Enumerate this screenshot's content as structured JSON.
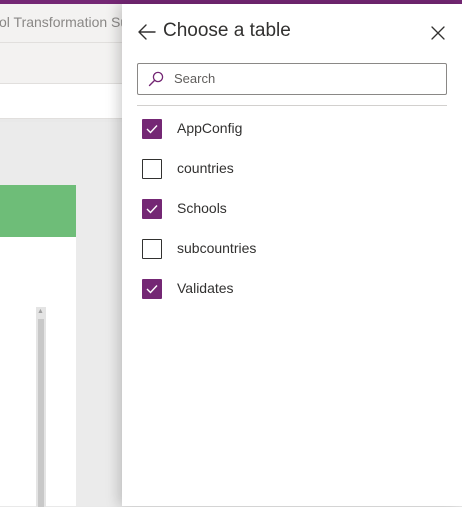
{
  "app": {
    "title_fragment": "ol Transformation Su"
  },
  "panel": {
    "title": "Choose a table",
    "back_icon": "arrow-left-icon",
    "close_icon": "close-icon",
    "search": {
      "placeholder": "Search",
      "value": "",
      "icon": "search-icon"
    },
    "tables": [
      {
        "label": "AppConfig",
        "checked": true
      },
      {
        "label": "countries",
        "checked": false
      },
      {
        "label": "Schools",
        "checked": true
      },
      {
        "label": "subcountries",
        "checked": false
      },
      {
        "label": "Validates",
        "checked": true
      }
    ]
  },
  "colors": {
    "accent": "#742774",
    "screen_header": "#6ebd78"
  }
}
